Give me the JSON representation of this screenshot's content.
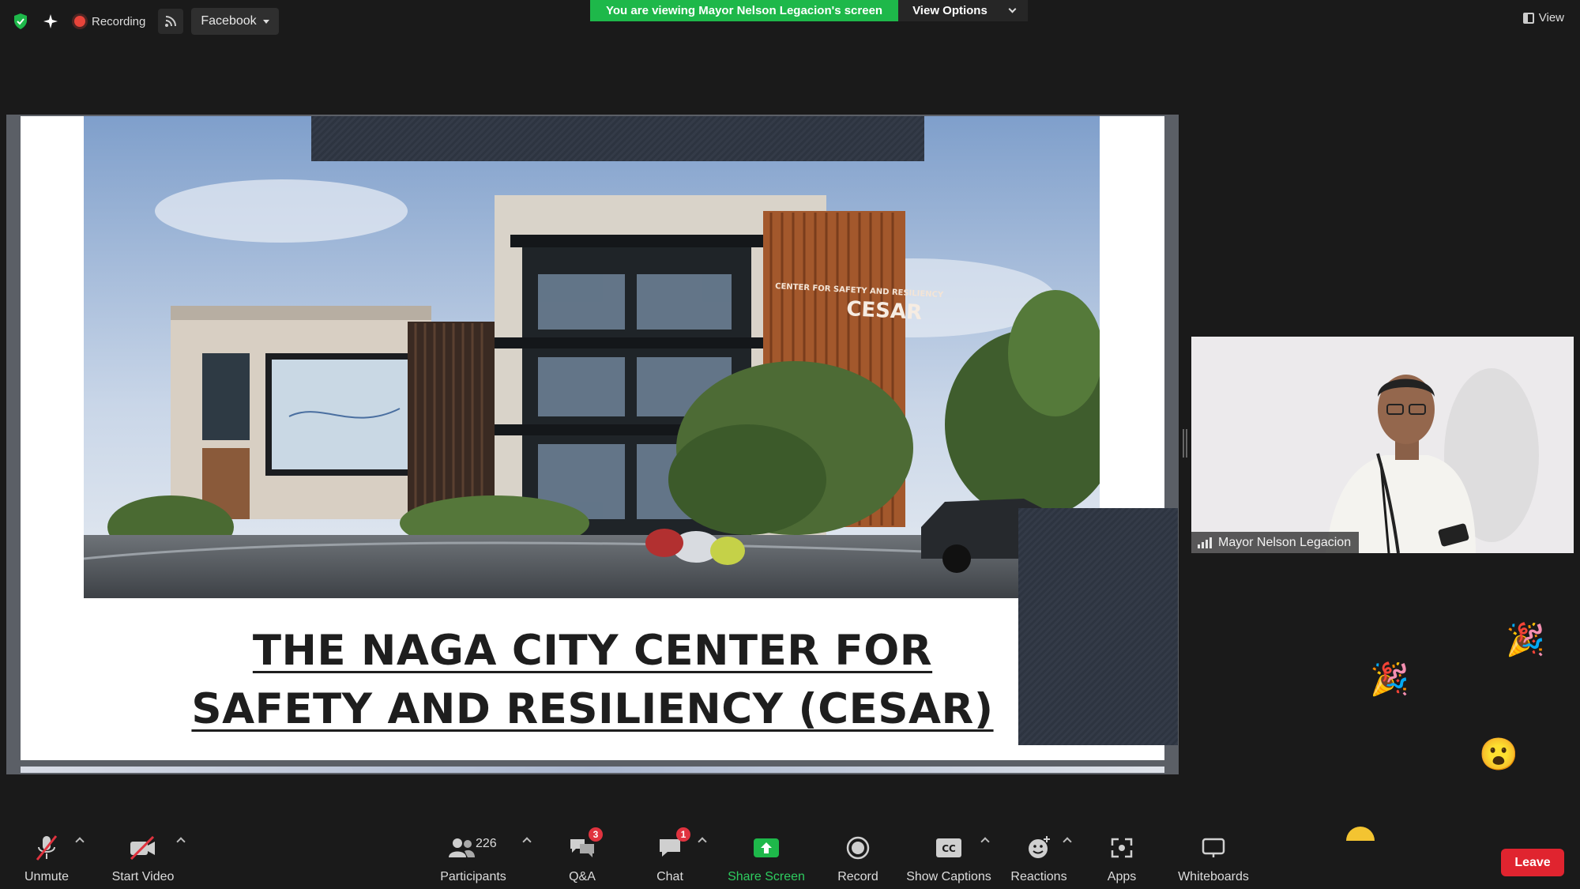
{
  "topbar": {
    "recording_label": "Recording",
    "stream_target": "Facebook",
    "viewing_banner": "You are viewing Mayor Nelson Legacion's screen",
    "view_options_label": "View Options",
    "view_label": "View"
  },
  "slide": {
    "title_line1": "THE NAGA CITY CENTER FOR",
    "title_line2": "SAFETY AND RESILIENCY (CESAR)",
    "building_sign_small": "CENTER FOR SAFETY AND RESILIENCY",
    "building_sign_large": "CESAR"
  },
  "video": {
    "participant_name": "Mayor Nelson Legacion"
  },
  "reactions": [
    "party-popper",
    "party-popper",
    "surprised-face"
  ],
  "toolbar": {
    "unmute_label": "Unmute",
    "start_video_label": "Start Video",
    "participants_label": "Participants",
    "participants_count": "226",
    "qa_label": "Q&A",
    "qa_badge": "3",
    "chat_label": "Chat",
    "chat_badge": "1",
    "share_screen_label": "Share Screen",
    "record_label": "Record",
    "captions_label": "Show Captions",
    "reactions_label": "Reactions",
    "apps_label": "Apps",
    "whiteboards_label": "Whiteboards",
    "leave_label": "Leave"
  },
  "colors": {
    "banner_green": "#1eb84a",
    "share_green": "#2ecc5f",
    "leave_red": "#e0242f",
    "badge_red": "#e0333f"
  }
}
